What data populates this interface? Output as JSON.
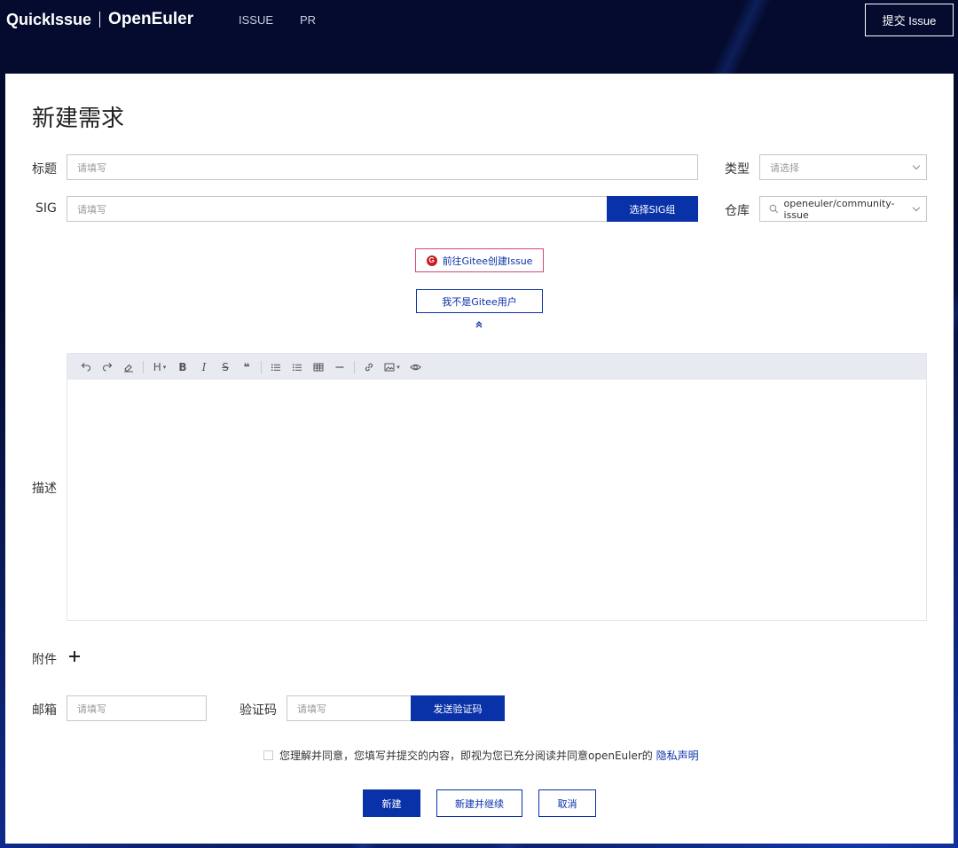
{
  "header": {
    "logo_left": "QuickIssue",
    "logo_right": "OpenEuler",
    "nav": [
      "ISSUE",
      "PR"
    ],
    "submit_label": "提交 Issue"
  },
  "form": {
    "page_title": "新建需求",
    "title_label": "标题",
    "title_placeholder": "请填写",
    "type_label": "类型",
    "type_placeholder": "请选择",
    "sig_label": "SIG",
    "sig_placeholder": "请填写",
    "sig_button": "选择SIG组",
    "repo_label": "仓库",
    "repo_value": "openeuler/community-issue",
    "gitee_button": "前往Gitee创建Issue",
    "gitee_logo_letter": "G",
    "not_gitee_button": "我不是Gitee用户",
    "desc_label": "描述",
    "attach_label": "附件",
    "email_label": "邮箱",
    "email_placeholder": "请填写",
    "code_label": "验证码",
    "code_placeholder": "请填写",
    "send_code_button": "发送验证码",
    "agree_text": "您理解并同意，您填写并提交的内容，即视为您已充分阅读并同意openEuler的",
    "privacy_link": "隐私声明",
    "create_button": "新建",
    "create_continue_button": "新建并继续",
    "cancel_button": "取消"
  },
  "editor_toolbar": {
    "heading": "H",
    "bold": "B",
    "italic": "I",
    "strike": "S",
    "quote": "❝"
  },
  "colors": {
    "primary": "#0a32a8",
    "header_bg": "#040b2e",
    "gitee_border": "#d24a6e",
    "gitee_red": "#c71d23"
  }
}
